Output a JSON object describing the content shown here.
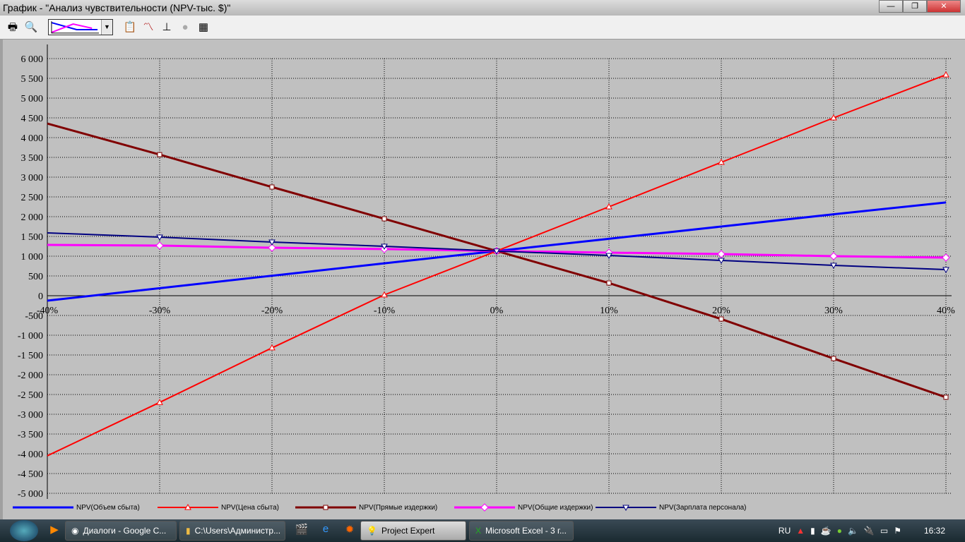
{
  "window": {
    "title": "График - \"Анализ чувствительности (NPV-тыс. $)\"",
    "min": "—",
    "max": "❐",
    "close": "✕"
  },
  "toolbar": {
    "icons": [
      "printer-icon",
      "print-preview-icon",
      "chart-type-combo",
      "properties-icon",
      "series-icon",
      "axes-icon",
      "disabled-icon",
      "table-icon"
    ]
  },
  "colors": {
    "blue": "#0000ff",
    "red": "#ff0000",
    "darkred": "#800000",
    "magenta": "#ff00ff",
    "navy": "#000080",
    "plot_bg": "#c0c0c0"
  },
  "chart_data": {
    "type": "line",
    "x": [
      "-40%",
      "-30%",
      "-20%",
      "-10%",
      "0%",
      "10%",
      "20%",
      "30%",
      "40%"
    ],
    "ylim": [
      -5000,
      6000
    ],
    "yticks": [
      "6 000",
      "5 500",
      "5 000",
      "4 500",
      "4 000",
      "3 500",
      "3 000",
      "2 500",
      "2 000",
      "1 500",
      "1 000",
      "500",
      "0",
      "-500",
      "-1 000",
      "-1 500",
      "-2 000",
      "-2 500",
      "-3 000",
      "-3 500",
      "-4 000",
      "-4 500",
      "-5 000"
    ],
    "grid": true,
    "legend_placement": "bottom",
    "series": [
      {
        "name": "NPV(Объем сбыта)",
        "color": "#0000ff",
        "marker": "none",
        "values": [
          -125,
          190,
          505,
          820,
          1130,
          1440,
          1750,
          2060,
          2360
        ]
      },
      {
        "name": "NPV(Цена сбыта)",
        "color": "#ff0000",
        "marker": "triangle",
        "values": [
          -4050,
          -2700,
          -1320,
          20,
          1130,
          2250,
          3375,
          4500,
          5590
        ]
      },
      {
        "name": "NPV(Прямые издержки)",
        "color": "#800000",
        "marker": "square",
        "values": [
          4357,
          3570,
          2750,
          1946,
          1130,
          321,
          -590,
          -1590,
          -2570
        ]
      },
      {
        "name": "NPV(Общие издержки)",
        "color": "#ff00ff",
        "marker": "diamond",
        "values": [
          1286,
          1268,
          1214,
          1180,
          1130,
          1090,
          1054,
          1000,
          964
        ]
      },
      {
        "name": "NPV(Зарплата персонала)",
        "color": "#000080",
        "marker": "triangle-down",
        "values": [
          1590,
          1482,
          1357,
          1250,
          1130,
          1018,
          893,
          768,
          660
        ]
      }
    ]
  },
  "taskbar": {
    "items": [
      "Диалоги - Google C...",
      "C:\\Users\\Администр...",
      "Project Expert",
      "Microsoft Excel - 3 г..."
    ],
    "lang": "RU",
    "clock": "16:32"
  }
}
